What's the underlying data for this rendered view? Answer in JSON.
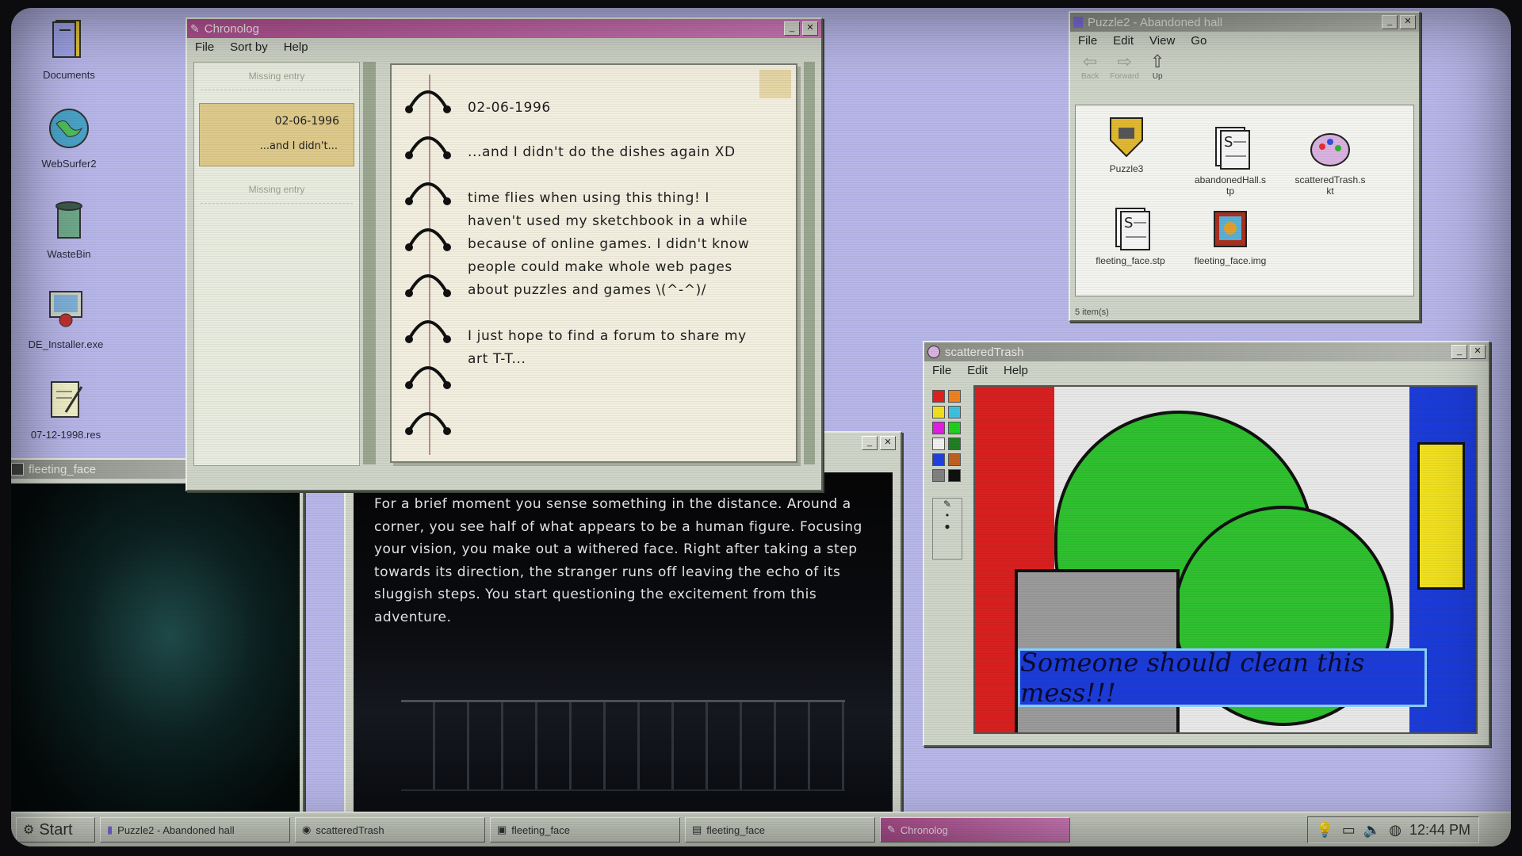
{
  "desktop": {
    "icons": [
      {
        "label": "Documents"
      },
      {
        "label": "WebSurfer2"
      },
      {
        "label": "WasteBin"
      },
      {
        "label": "DE_Installer.exe"
      },
      {
        "label": "07-12-1998.res"
      }
    ]
  },
  "chronolog": {
    "title": "Chronolog",
    "menu": [
      "File",
      "Sort by",
      "Help"
    ],
    "entries": [
      {
        "text": "Missing entry"
      },
      {
        "date": "02-06-1996",
        "preview": "...and I didn't..."
      },
      {
        "text": "Missing entry"
      }
    ],
    "page": {
      "date": "02-06-1996",
      "lines": [
        "...and I didn't do the dishes again XD",
        "time flies when using this thing! I",
        "haven't used my sketchbook in a while",
        "because of online games. I didn't know",
        "people could make whole web pages",
        "about puzzles and games \\(^-^)/",
        "I just hope to find a forum to share my",
        "art T-T..."
      ]
    }
  },
  "explorer": {
    "title": "Puzzle2 - Abandoned hall",
    "menu": [
      "File",
      "Edit",
      "View",
      "Go"
    ],
    "toolbar": [
      "Back",
      "Forward",
      "Up"
    ],
    "files": [
      {
        "name": "Puzzle3",
        "icon": "shield-folder-icon"
      },
      {
        "name": "abandonedHall.s\ntp",
        "icon": "script-icon"
      },
      {
        "name": "scatteredTrash.s\nkt",
        "icon": "paint-icon"
      },
      {
        "name": "fleeting_face.stp",
        "icon": "script-icon"
      },
      {
        "name": "fleeting_face.img",
        "icon": "image-icon"
      }
    ],
    "status": "5 item(s)"
  },
  "paint": {
    "title": "scatteredTrash",
    "menu": [
      "File",
      "Edit",
      "Help"
    ],
    "caption": "Someone should clean this mess!!!",
    "colors": [
      "#e02020",
      "#f08020",
      "#f0e020",
      "#40c0e0",
      "#e020e0",
      "#20d020",
      "#f0f0f0",
      "#208020",
      "#2040e0",
      "#c06020",
      "#808080",
      "#101010"
    ]
  },
  "fleeting": {
    "title": "fleeting_face"
  },
  "story": {
    "text": "For a brief moment you sense something in the distance. Around a corner, you see half of what appears to be a human figure. Focusing your vision, you make out a withered face. Right after taking a step towards its direction, the stranger runs off leaving the echo of its sluggish steps. You start questioning the excitement from this adventure."
  },
  "taskbar": {
    "start": "Start",
    "items": [
      "Puzzle2 - Abandoned hall",
      "scatteredTrash",
      "fleeting_face",
      "fleeting_face",
      "Chronolog"
    ],
    "clock": "12:44 PM"
  }
}
